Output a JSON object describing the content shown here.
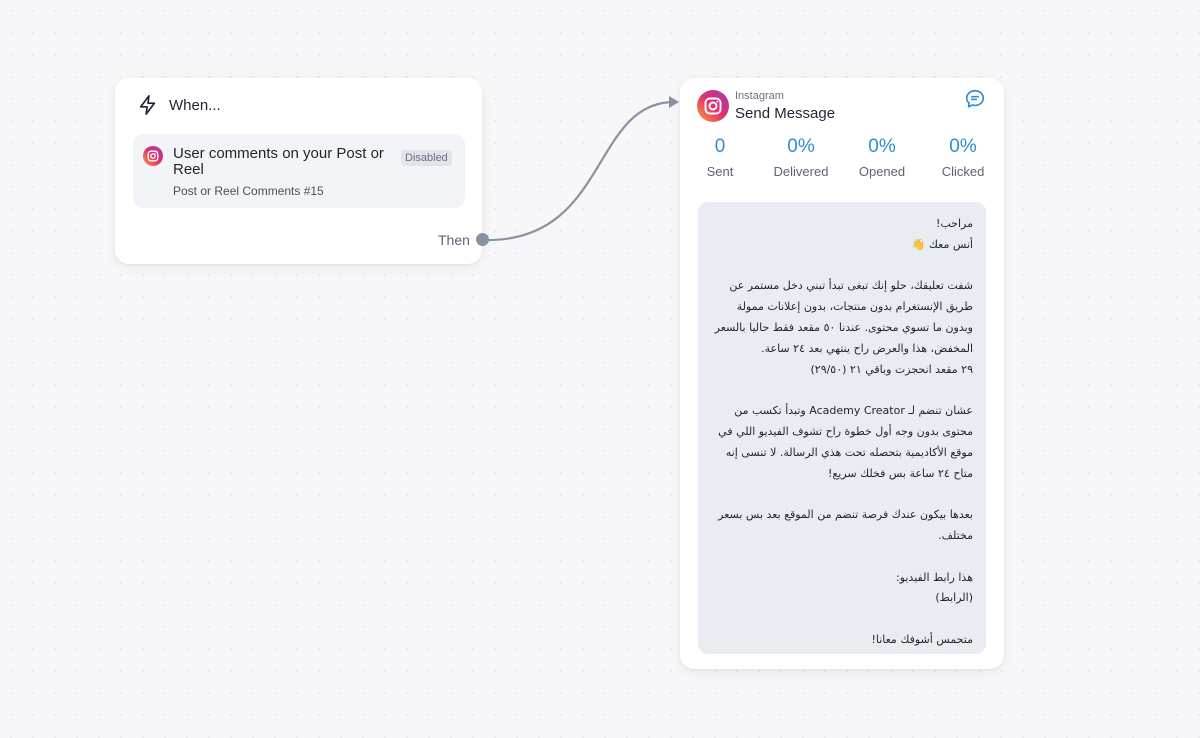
{
  "colors": {
    "accent": "#2d8ed1",
    "connector": "#8a91a1",
    "card_background": "#ffffff",
    "message_background": "#e9edf1"
  },
  "trigger": {
    "icon": "lightning-bolt-icon",
    "title": "When...",
    "event": {
      "icon": "instagram-icon",
      "title": "User comments on your Post or Reel",
      "subtitle": "Post or Reel Comments #15",
      "badge": "Disabled"
    },
    "then_label": "Then"
  },
  "action": {
    "icon": "instagram-icon",
    "platform": "Instagram",
    "title": "Send Message",
    "corner_icon": "chat-bubble-icon",
    "stats": [
      {
        "value": "0",
        "label": "Sent"
      },
      {
        "value": "0%",
        "label": "Delivered"
      },
      {
        "value": "0%",
        "label": "Opened"
      },
      {
        "value": "0%",
        "label": "Clicked"
      }
    ],
    "message": "مراحب!\nأنس معك 👋\n\nشفت تعليقك، حلو إنك تبغى تبدأ تبني دخل مستمر عن طريق الإنستغرام بدون منتجات، بدون إعلانات ممولة وبدون ما تسوي محتوى. عندنا ٥٠ مقعد فقط حاليا بالسعر المخفض، هذا والعرض راح ينتهي بعد ٢٤ ساعة.\n٢٩ مقعد انحجزت وباقي ٢١ (٢٩/٥٠)\n\nعشان تنضم لـ Academy Creator وتبدأ تكسب من محتوى بدون وجه أول خطوة راح تشوف الفيديو اللي في موقع الأكاديمية بتحصله تحت هذي الرسالة. لا تنسى إنه متاح ٢٤ ساعة بس فخلك سريع!\n\nبعدها بيكون عندك فرصة تنضم من الموقع بعد بس بسعر مختلف.\n\nهذا رابط الفيديو:\n(الرابط)\n\nمتحمس أشوفك معانا!"
  }
}
